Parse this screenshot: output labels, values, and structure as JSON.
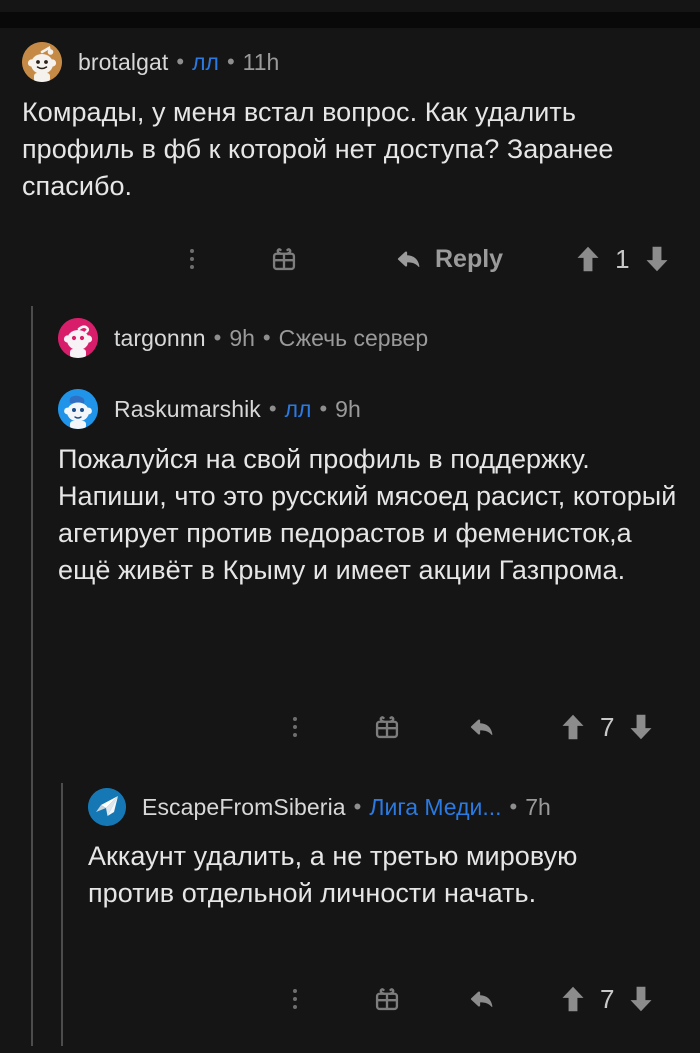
{
  "app": {
    "theme": "dark",
    "background_color": "#151515",
    "link_color": "#2a7ae2",
    "thread_line_color": "#4c4c4c"
  },
  "comments": [
    {
      "id": "comment-1",
      "depth": 0,
      "avatar": {
        "icon_name": "snoo-avatar-orange",
        "color": "#c58a45"
      },
      "author": "brotalgat",
      "separator": "•",
      "flair": "лл",
      "flair_is_link": true,
      "timestamp": "11h",
      "body": "Комрады, у меня встал вопрос. Как удалить профиль в фб к которой нет доступа? Заранее спасибо.",
      "actions": {
        "more_icon": "more-vertical-icon",
        "gift_icon": "gift-icon",
        "reply_icon": "reply-arrow-icon",
        "reply_label": "Reply",
        "show_reply_label": true,
        "upvote_icon": "upvote-arrow-icon",
        "downvote_icon": "downvote-arrow-icon",
        "vote_count": "1"
      }
    },
    {
      "id": "comment-2",
      "depth": 1,
      "avatar": {
        "icon_name": "snoo-avatar-pink",
        "color": "#d81e6a"
      },
      "author": "targonnn",
      "separator": "•",
      "flair": "Сжечь сервер",
      "flair_is_link": false,
      "timestamp": "9h",
      "body": "",
      "actions": null
    },
    {
      "id": "comment-3",
      "depth": 1,
      "avatar": {
        "icon_name": "snoo-avatar-blue",
        "color": "#1f94e8"
      },
      "author": "Raskumarshik",
      "separator": "•",
      "flair": "лл",
      "flair_is_link": true,
      "timestamp": "9h",
      "body": "Пожалуйся на свой профиль в поддержку. Напиши, что это русский мясоед расист, который агетирует против педорастов и феменисток,а ещё живёт в Крыму и имеет акции Газпрома.",
      "actions": {
        "more_icon": "more-vertical-icon",
        "gift_icon": "gift-icon",
        "reply_icon": "reply-arrow-icon",
        "reply_label": "Reply",
        "show_reply_label": false,
        "upvote_icon": "upvote-arrow-icon",
        "downvote_icon": "downvote-arrow-icon",
        "vote_count": "7"
      }
    },
    {
      "id": "comment-4",
      "depth": 2,
      "avatar": {
        "icon_name": "paper-plane-avatar-blue",
        "color": "#1578b4"
      },
      "author": "EscapeFromSiberia",
      "separator": "•",
      "flair": "Лига Меди...",
      "flair_is_link": true,
      "timestamp": "7h",
      "body": "Аккаунт удалить, а не третью мировую против отдельной личности начать.",
      "actions": {
        "more_icon": "more-vertical-icon",
        "gift_icon": "gift-icon",
        "reply_icon": "reply-arrow-icon",
        "reply_label": "Reply",
        "show_reply_label": false,
        "upvote_icon": "upvote-arrow-icon",
        "downvote_icon": "downvote-arrow-icon",
        "vote_count": "7"
      }
    }
  ]
}
